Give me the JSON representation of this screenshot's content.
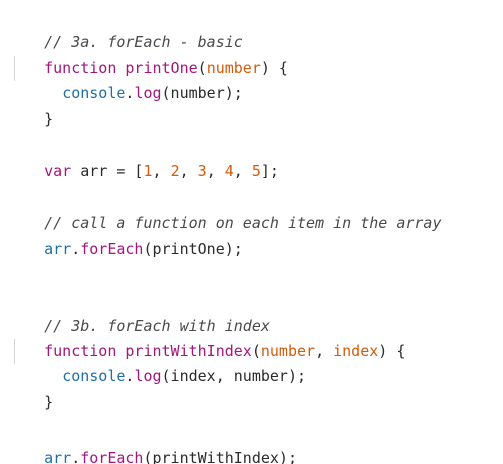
{
  "editor": {
    "colors": {
      "comment": "#4a4a4a",
      "keyword": "#a3167c",
      "function_name": "#a3167c",
      "parameter": "#d35c0c",
      "number": "#d35c0c",
      "property": "#1f6fa3",
      "text": "#2b2b2b"
    },
    "lines": {
      "l1": {
        "comment": "// 3a. forEach - basic"
      },
      "l2": {
        "kw": "function",
        "sp1": " ",
        "fn": "printOne",
        "open": "(",
        "param": "number",
        "close": ") {"
      },
      "l3": {
        "indent": "  ",
        "obj": "console",
        "dot": ".",
        "method": "log",
        "rest": "(number);"
      },
      "l4": {
        "text": "}"
      },
      "l6": {
        "kw": "var",
        "mid": " arr = [",
        "n1": "1",
        "c1": ", ",
        "n2": "2",
        "c2": ", ",
        "n3": "3",
        "c3": ", ",
        "n4": "4",
        "c4": ", ",
        "n5": "5",
        "end": "];"
      },
      "l8": {
        "comment": "// call a function on each item in the array"
      },
      "l9": {
        "obj": "arr",
        "dot": ".",
        "method": "forEach",
        "rest": "(printOne);"
      },
      "l12": {
        "comment": "// 3b. forEach with index"
      },
      "l13": {
        "kw": "function",
        "sp1": " ",
        "fn": "printWithIndex",
        "open": "(",
        "param1": "number",
        "comma": ", ",
        "param2": "index",
        "close": ") {"
      },
      "l14": {
        "indent": "  ",
        "obj": "console",
        "dot": ".",
        "method": "log",
        "rest": "(index, number);"
      },
      "l15": {
        "text": "}"
      },
      "l17": {
        "obj": "arr",
        "dot": ".",
        "method": "forEach",
        "rest": "(printWithIndex);"
      }
    }
  }
}
